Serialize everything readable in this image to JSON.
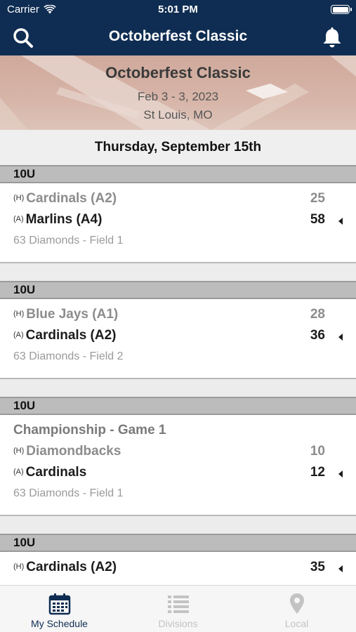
{
  "status_bar": {
    "carrier": "Carrier",
    "time": "5:01 PM"
  },
  "nav": {
    "title": "Octoberfest Classic",
    "left_icon": "search-icon",
    "right_icon": "bell-icon"
  },
  "hero": {
    "title": "Octoberfest Classic",
    "dates": "Feb 3 - 3, 2023",
    "location": "St Louis, MO"
  },
  "day_header": "Thursday, September 15th",
  "groups": [
    {
      "division": "10U",
      "label": "",
      "home": {
        "tag": "(H)",
        "team": "Cardinals (A2)",
        "score": "25",
        "winner": false
      },
      "away": {
        "tag": "(A)",
        "team": "Marlins (A4)",
        "score": "58",
        "winner": true
      },
      "venue": "63 Diamonds - Field 1"
    },
    {
      "division": "10U",
      "label": "",
      "home": {
        "tag": "(H)",
        "team": "Blue Jays (A1)",
        "score": "28",
        "winner": false
      },
      "away": {
        "tag": "(A)",
        "team": "Cardinals (A2)",
        "score": "36",
        "winner": true
      },
      "venue": "63 Diamonds - Field 2"
    },
    {
      "division": "10U",
      "label": "Championship - Game 1",
      "home": {
        "tag": "(H)",
        "team": "Diamondbacks",
        "score": "10",
        "winner": false
      },
      "away": {
        "tag": "(A)",
        "team": "Cardinals",
        "score": "12",
        "winner": true
      },
      "venue": "63 Diamonds - Field 1"
    },
    {
      "division": "10U",
      "label": "",
      "home": {
        "tag": "(H)",
        "team": "Cardinals (A2)",
        "score": "35",
        "winner": true
      },
      "away": null,
      "venue": ""
    }
  ],
  "tabs": [
    {
      "label": "My Schedule",
      "icon": "calendar-icon",
      "active": true
    },
    {
      "label": "Divisions",
      "icon": "list-icon",
      "active": false
    },
    {
      "label": "Local",
      "icon": "location-pin-icon",
      "active": false
    }
  ],
  "colors": {
    "nav_bg": "#0f2d52",
    "active_tab": "#0f2d52",
    "inactive_tab": "#c3c3c3",
    "division_header": "#bcbcbc"
  }
}
